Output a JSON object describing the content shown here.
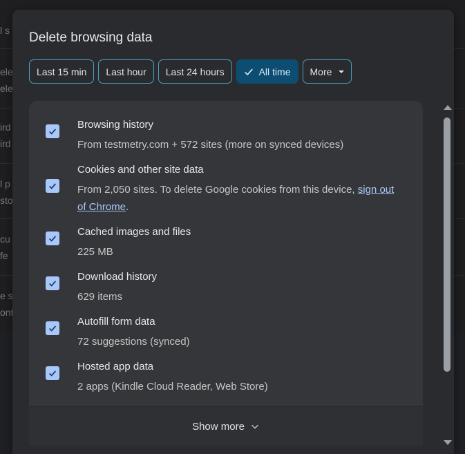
{
  "dialog": {
    "title": "Delete browsing data"
  },
  "time_range": {
    "chips": [
      {
        "label": "Last 15 min",
        "selected": false
      },
      {
        "label": "Last hour",
        "selected": false
      },
      {
        "label": "Last 24 hours",
        "selected": false
      },
      {
        "label": "All time",
        "selected": true
      },
      {
        "label": "More",
        "selected": false
      }
    ]
  },
  "items": [
    {
      "title": "Browsing history",
      "sub": "From testmetry.com + 572 sites (more on synced devices)",
      "checked": true
    },
    {
      "title": "Cookies and other site data",
      "sub": "From 2,050 sites. To delete Google cookies from this device, ",
      "link": "sign out of Chrome",
      "sub_end": ".",
      "checked": true
    },
    {
      "title": "Cached images and files",
      "sub": "225 MB",
      "checked": true
    },
    {
      "title": "Download history",
      "sub": "629 items",
      "checked": true
    },
    {
      "title": "Autofill form data",
      "sub": "72 suggestions (synced)",
      "checked": true
    },
    {
      "title": "Hosted app data",
      "sub": "2 apps (Kindle Cloud Reader, Web Store)",
      "checked": true
    }
  ],
  "show_more": {
    "label": "Show more"
  },
  "background": {
    "fragments": [
      "l s",
      "elet",
      "elet",
      "ird",
      "ird",
      "l p",
      "sto",
      "cu",
      "fe",
      "e s",
      "ont"
    ]
  },
  "colors": {
    "accent": "#a8c7fa",
    "chip_border": "#4c9fc4",
    "chip_selected_bg": "#0e4d72",
    "dialog_bg": "#2a2b2f",
    "panel_bg": "#35363a"
  }
}
